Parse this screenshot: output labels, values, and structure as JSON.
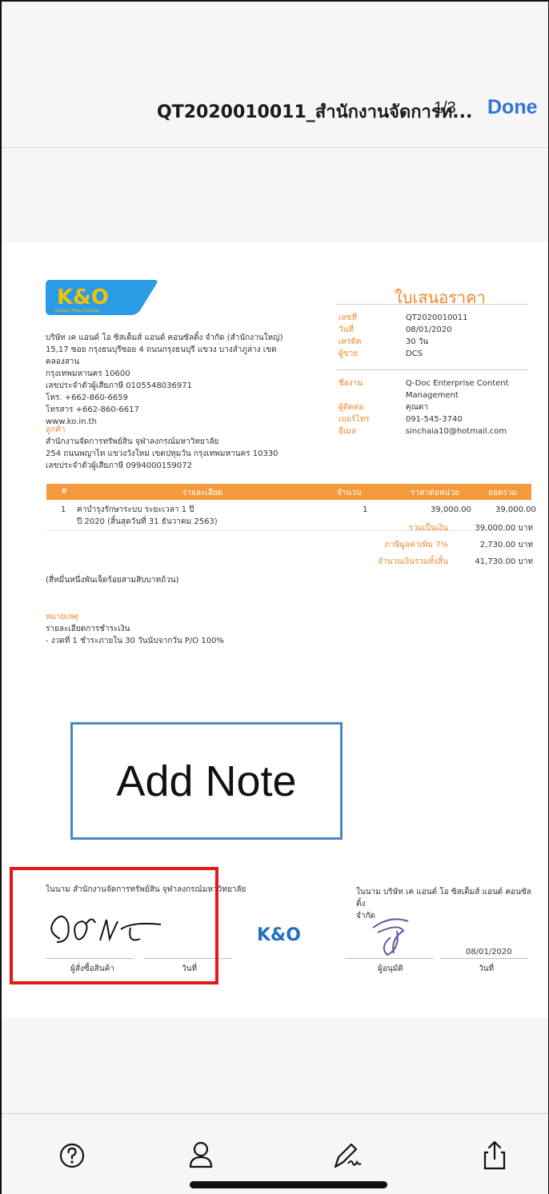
{
  "header": {
    "title": "QT2020010011_สำนักงานจัดการท...",
    "page_counter": "1/3",
    "done_label": "Done"
  },
  "document": {
    "logo_text": "K&O",
    "logo_tagline": "Passion Make Possible",
    "company_lines": [
      "บริษัท เค แอนด์ โอ ซิสเต็มส์ แอนด์ คอนซัลติ้ง จำกัด (สำนักงานใหญ่)",
      "15,17 ซอย กรุงธนบุรีซอย 4 ถนนกรุงธนบุรี แขวง บางลำภูล่าง เขตคลองสาน",
      "กรุงเทพมหานคร 10600",
      "เลขประจำตัวผู้เสียภาษี 0105548036971",
      "โทร. +662-860-6659",
      "โทรสาร +662-860-6617",
      "www.ko.in.th"
    ],
    "customer_label": "ลูกค้า",
    "customer_lines": [
      "สำนักงานจัดการทรัพย์สิน จุฬาลงกรณ์มหาวิทยาลัย",
      "254 ถนนพญาไท แขวงวังใหม่ เขตปทุมวัน กรุงเทพมหานคร 10330",
      "เลขประจำตัวผู้เสียภาษี 0994000159072"
    ],
    "quote_title": "ใบเสนอราคา",
    "meta_top": [
      {
        "k": "เลขที่",
        "v": "QT2020010011"
      },
      {
        "k": "วันที่",
        "v": "08/01/2020"
      },
      {
        "k": "เครดิต",
        "v": "30 วัน"
      },
      {
        "k": "ผู้ขาย",
        "v": "DCS"
      }
    ],
    "meta_bottom": [
      {
        "k": "ชื่องาน",
        "v": "Q-Doc Enterprise Content"
      },
      {
        "k": "",
        "v": "Management"
      },
      {
        "k": "ผู้ติดต่อ",
        "v": "คุณตา"
      },
      {
        "k": "เบอร์โทร",
        "v": "091-545-3740"
      },
      {
        "k": "อีเมล",
        "v": "sinchaia10@hotmail.com"
      }
    ],
    "table_headers": {
      "no": "#",
      "desc": "รายละเอียด",
      "qty": "จำนวน",
      "unit_price": "ราคาต่อหน่วย",
      "amount": "ยอดรวม"
    },
    "items": [
      {
        "no": "1",
        "desc_1": "ค่าบำรุงรักษาระบบ ระยะเวลา 1 ปี",
        "desc_2": "ปี 2020 (สิ้นสุดวันที่ 31 ธันวาคม 2563)",
        "qty": "1",
        "unit_price": "39,000.00",
        "amount": "39,000.00"
      }
    ],
    "totals": [
      {
        "k": "รวมเป็นเงิน",
        "v": "39,000.00 บาท"
      },
      {
        "k": "ภาษีมูลค่าเพิ่ม 7%",
        "v": "2,730.00 บาท"
      },
      {
        "k": "จำนวนเงินรวมทั้งสิ้น",
        "v": "41,730.00 บาท"
      }
    ],
    "amount_in_words": "(สี่หมื่นหนึ่งพันเจ็ดร้อยสามสิบบาทถ้วน)",
    "remarks_label": "หมายเหตุ",
    "remarks_lines": [
      "รายละเอียดการชำระเงิน",
      " - งวดที่ 1 ชำระภายใน 30 วันนับจากวัน P/O 100%"
    ],
    "signature_left_title": "ในนาม สำนักงานจัดการทรัพย์สิน จุฬาลงกรณ์มหาวิทยาลัย",
    "signature_left_label": "ผู้สั่งซื้อสินค้า",
    "signature_left_date_label": "วันที่",
    "signature_right_title_1": "ในนาม บริษัท เค แอนด์ โอ ซิสเต็มส์ แอนด์ คอนซัลติ้ง",
    "signature_right_title_2": "จำกัด",
    "signature_right_label": "ผู้อนุมัติ",
    "signature_right_date_label": "วันที่",
    "signature_right_date": "08/01/2020",
    "mini_logo_text": "K&O"
  },
  "overlay": {
    "note_label": "Add Note"
  },
  "toolbar": {
    "icons": [
      "help-icon",
      "person-icon",
      "signature-icon",
      "share-icon"
    ]
  },
  "colors": {
    "accent_blue": "#2f73d9",
    "doc_orange": "#ee8a2a",
    "table_header": "#f39a3c",
    "note_border": "#4a86c8",
    "highlight_red": "#e11919"
  }
}
